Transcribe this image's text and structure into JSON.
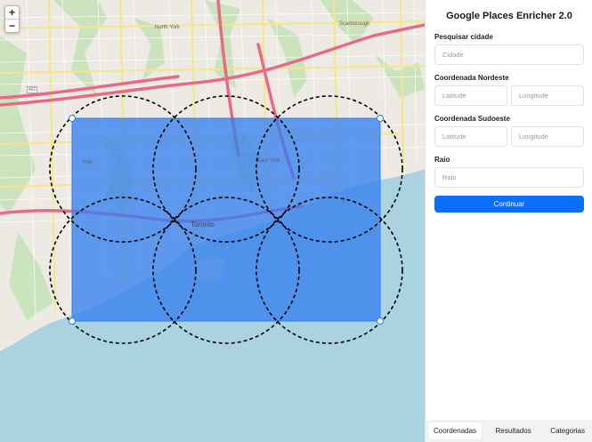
{
  "app": {
    "title": "Google Places Enricher 2.0"
  },
  "map": {
    "zoom_in_label": "+",
    "zoom_out_label": "−",
    "place_labels": {
      "north_york": "North York",
      "scarborough": "Scarborough",
      "toronto": "Toronto",
      "east_york": "East York",
      "york": "York",
      "highway_401": "401"
    },
    "selection_color": "#2f7cf0",
    "circle_color": "#000000"
  },
  "panel": {
    "city_search": {
      "label": "Pesquisar cidade",
      "placeholder": "Cidade",
      "value": ""
    },
    "northeast": {
      "label": "Coordenada Nordeste",
      "lat_placeholder": "Latitude",
      "lng_placeholder": "Longitude"
    },
    "southwest": {
      "label": "Coordenada Sudoeste",
      "lat_placeholder": "Latitude",
      "lng_placeholder": "Longitude"
    },
    "radius": {
      "label": "Raio",
      "placeholder": "Raio"
    },
    "continue_label": "Continuar",
    "accent_color": "#0a6ef6"
  },
  "tabs": [
    {
      "label": "Coordenadas",
      "active": true
    },
    {
      "label": "Resultados",
      "active": false
    },
    {
      "label": "Categorias",
      "active": false
    }
  ]
}
